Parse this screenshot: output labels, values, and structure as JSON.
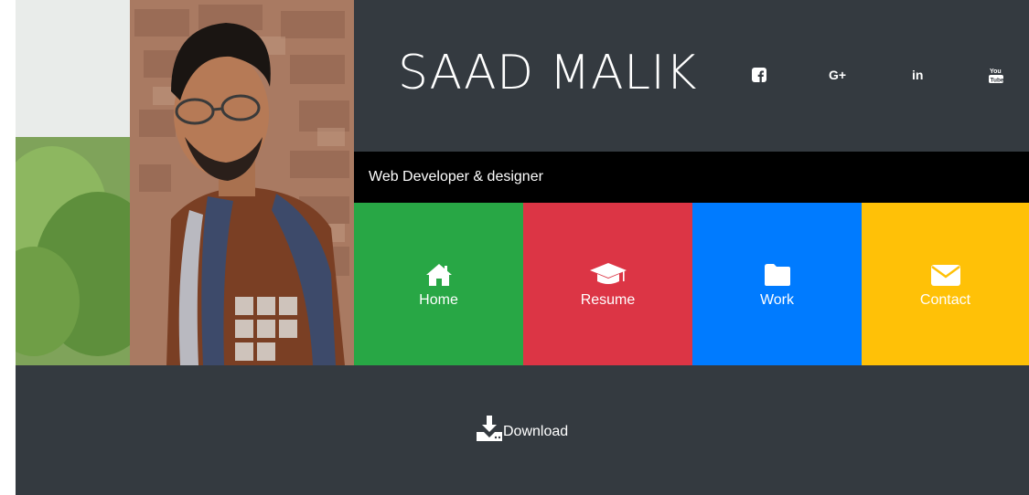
{
  "profile": {
    "name": "SAAD MALIK",
    "tagline": "Web Developer & designer",
    "photo_alt": "portrait-photo"
  },
  "social": [
    {
      "icon": "facebook-icon"
    },
    {
      "icon": "google-plus-icon"
    },
    {
      "icon": "linkedin-icon"
    },
    {
      "icon": "youtube-icon"
    }
  ],
  "nav": {
    "home": {
      "label": "Home",
      "icon": "home-icon",
      "color": "#28a745"
    },
    "resume": {
      "label": "Resume",
      "icon": "graduation-cap-icon",
      "color": "#dc3545"
    },
    "work": {
      "label": "Work",
      "icon": "folder-icon",
      "color": "#007bff"
    },
    "contact": {
      "label": "Contact",
      "icon": "envelope-icon",
      "color": "#ffc107"
    }
  },
  "footer": {
    "download_label": "Download",
    "download_icon": "download-icon"
  },
  "colors": {
    "dark": "#343a40",
    "black": "#000000",
    "white": "#ffffff"
  }
}
